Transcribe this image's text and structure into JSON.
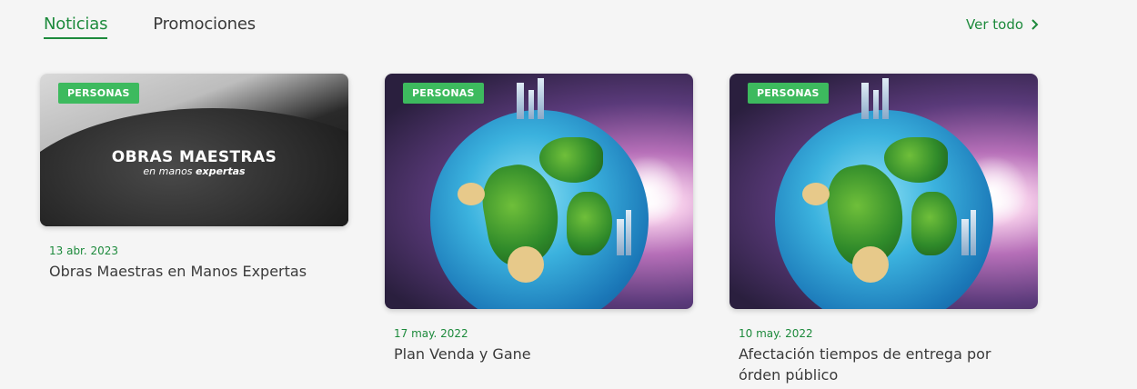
{
  "tabs": [
    {
      "label": "Noticias",
      "active": true
    },
    {
      "label": "Promociones",
      "active": false
    }
  ],
  "ver_todo": {
    "label": "Ver todo",
    "icon": "chevron-right-icon"
  },
  "cards": [
    {
      "badge": "PERSONAS",
      "image_headline": "OBRAS MAESTRAS",
      "image_sub_prefix": "en manos",
      "image_sub_bold": "expertas",
      "date": "13 abr. 2023",
      "title": "Obras Maestras en Manos Expertas"
    },
    {
      "badge": "PERSONAS",
      "date": "17 may. 2022",
      "title": "Plan Venda y Gane"
    },
    {
      "badge": "PERSONAS",
      "date": "10 may. 2022",
      "title": "Afectación tiempos de entrega por órden público"
    }
  ],
  "colors": {
    "accent": "#1d8a3c",
    "badge": "#3dba5e",
    "text": "#3a3a3a",
    "background": "#f5f5f5"
  }
}
